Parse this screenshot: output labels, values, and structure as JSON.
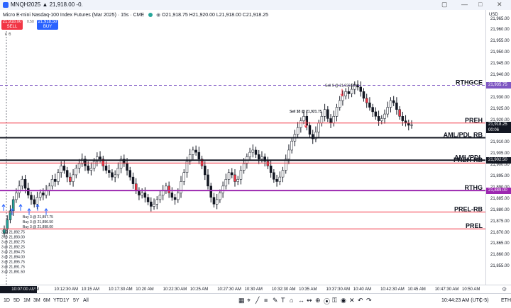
{
  "tab": {
    "title": "MNQH2025 ▲ 21,918.00 -0."
  },
  "window_controls": {
    "restore": "▢",
    "minimize": "—",
    "maximize": "□",
    "close": "✕"
  },
  "legend": {
    "symbol": "Micro E-mini Nasdaq-100 Index Futures (Mar 2025) · 15s · CME",
    "ohlc": "O21,918.75 H21,920.00 L21,918.00 C21,918.25",
    "market_status_icon": "eye-icon"
  },
  "trading": {
    "sell_price": "21,918.00",
    "sell_label": "SELL",
    "spread": "0.50",
    "buy_price": "21,918.50",
    "buy_label": "BUY",
    "quantity": "6"
  },
  "colors": {
    "up": "#26a69a",
    "down": "#f23645",
    "level_red": "#f23645",
    "level_black": "#131722",
    "level_purple": "#9c27b0",
    "level_dashed": "#7e57c2",
    "buy_marker": "#2962ff"
  },
  "price_axis": {
    "currency": "USD",
    "ticks": [
      "21,965.00",
      "21,960.00",
      "21,955.00",
      "21,950.00",
      "21,945.00",
      "21,940.00",
      "21,935.00",
      "21,930.00",
      "21,925.00",
      "21,920.00",
      "21,915.00",
      "21,910.00",
      "21,905.00",
      "21,900.00",
      "21,895.00",
      "21,890.00",
      "21,885.00",
      "21,880.00",
      "21,875.00",
      "21,870.00",
      "21,865.00",
      "21,860.00",
      "21,855.00"
    ],
    "labels": [
      {
        "value": "21,935.75",
        "color": "#7e57c2"
      },
      {
        "value": "21,902.50",
        "color": "#131722"
      },
      {
        "value": "21,889.00",
        "color": "#9c27b0"
      }
    ],
    "current_price": "21,918.25",
    "countdown": "00:06"
  },
  "levels": [
    {
      "name": "RTHGCE",
      "price": 21935.75,
      "color": "#7e57c2",
      "style": "dashed",
      "width": 1
    },
    {
      "name": "PREH",
      "price": 21919,
      "color": "#f23645",
      "style": "solid",
      "width": 1
    },
    {
      "name": "AML/PDL RB",
      "price": 21912.5,
      "color": "#131722",
      "style": "solid",
      "width": 2
    },
    {
      "name": "AML/PDL",
      "price": 21902.5,
      "color": "#131722",
      "style": "solid",
      "width": 2
    },
    {
      "name": "PREH-RB",
      "price": 21901.25,
      "color": "#f23645",
      "style": "solid",
      "width": 1
    },
    {
      "name": "RTHG",
      "price": 21889,
      "color": "#9c27b0",
      "style": "solid",
      "width": 2
    },
    {
      "name": "PREL-RB",
      "price": 21879.5,
      "color": "#f23645",
      "style": "solid",
      "width": 1
    },
    {
      "name": "PREL",
      "price": 21872,
      "color": "#f23645",
      "style": "solid",
      "width": 1
    }
  ],
  "time_axis": {
    "cursor": "10:07:00 AM",
    "ticks": [
      "10 AM",
      "10:12:30 AM",
      "10:15 AM",
      "10:17:30 AM",
      "10:20 AM",
      "10:22:30 AM",
      "10:25 AM",
      "10:27:30 AM",
      "10:30 AM",
      "10:32:30 AM",
      "10:35 AM",
      "10:37:30 AM",
      "10:40 AM",
      "10:42:30 AM",
      "10:45 AM",
      "10:47:30 AM",
      "10:50 AM"
    ],
    "settings_icon": "gear-icon"
  },
  "executions": {
    "buys": [
      "Buy 3 @ 21,897.75",
      "Buy 3 @ 21,896.50",
      "Buy 3 @ 21,898.00"
    ],
    "sells": [
      "Sell 18 @ 21,921.75",
      "Sell 33 @ 21,921.75",
      "Sell 9 @ 21,933.25"
    ],
    "left_column": [
      "3 @ 21,892.75",
      "3 @ 21,893.00",
      "3 @ 21,892.75",
      "3 @ 21,892.25",
      "3 @ 21,894.75",
      "3 @ 21,894.00",
      "3 @ 21,895.75",
      "3 @ 21,891.75",
      "3 @ 21,891.50"
    ]
  },
  "bottom_bar": {
    "ranges": [
      "1D",
      "5D",
      "1M",
      "3M",
      "6M",
      "YTD",
      "1Y",
      "5Y",
      "All"
    ],
    "tools": [
      "calendar-icon",
      "cursor-icon",
      "trendline-icon",
      "fib-icon",
      "brush-icon",
      "text-icon",
      "pattern-icon",
      "measure-icon",
      "ruler-icon",
      "zoom-icon",
      "magnet-icon",
      "lock-icon",
      "eye-icon",
      "trash-icon",
      "undo-icon",
      "redo-icon"
    ],
    "clock": "10:44:23 AM (UTC-5)",
    "extended": "ETH"
  },
  "chart_data": {
    "type": "candlestick",
    "symbol": "MNQH2025",
    "interval": "15s",
    "title": "Micro E-mini Nasdaq-100 Index Futures (Mar 2025)",
    "ylim": [
      21851,
      21968
    ],
    "x_categories": [
      "10 AM",
      "10:12:30 AM",
      "10:15 AM",
      "10:17:30 AM",
      "10:20 AM",
      "10:22:30 AM",
      "10:25 AM",
      "10:27:30 AM",
      "10:30 AM",
      "10:32:30 AM",
      "10:35 AM",
      "10:37:30 AM",
      "10:40 AM",
      "10:42:30 AM",
      "10:45 AM",
      "10:47:30 AM",
      "10:50 AM"
    ],
    "path_close": [
      21872,
      21876,
      21880,
      21885,
      21888,
      21891,
      21894,
      21890,
      21887,
      21885,
      21883,
      21886,
      21888,
      21887,
      21889,
      21891,
      21894,
      21893,
      21897,
      21900,
      21898,
      21895,
      21893,
      21896,
      21899,
      21901,
      21903,
      21900,
      21898,
      21899,
      21902,
      21904,
      21903,
      21900,
      21898,
      21897,
      21895,
      21896,
      21899,
      21903,
      21901,
      21898,
      21895,
      21892,
      21889,
      21887,
      21888,
      21886,
      21884,
      21882,
      21883,
      21885,
      21887,
      21889,
      21891,
      21888,
      21886,
      21885,
      21888,
      21893,
      21897,
      21902,
      21905,
      21907,
      21906,
      21903,
      21900,
      21896,
      21891,
      21886,
      21883,
      21885,
      21888,
      21891,
      21894,
      21897,
      21896,
      21893,
      21894,
      21898,
      21901,
      21904,
      21906,
      21907,
      21905,
      21903,
      21904,
      21902,
      21900,
      21897,
      21894,
      21893,
      21895,
      21898,
      21903,
      21907,
      21911,
      21914,
      21917,
      21920,
      21922,
      21918,
      21914,
      21912,
      21915,
      21919,
      21922,
      21925,
      21921,
      21919,
      21922,
      21926,
      21929,
      21931,
      21933,
      21932,
      21934,
      21936,
      21935,
      21933,
      21930,
      21928,
      21926,
      21924,
      21922,
      21920,
      21921,
      21923,
      21926,
      21929,
      21928,
      21925,
      21922,
      21920,
      21919,
      21918,
      21918.25
    ],
    "levels_ref": "levels",
    "current": 21918.25
  }
}
